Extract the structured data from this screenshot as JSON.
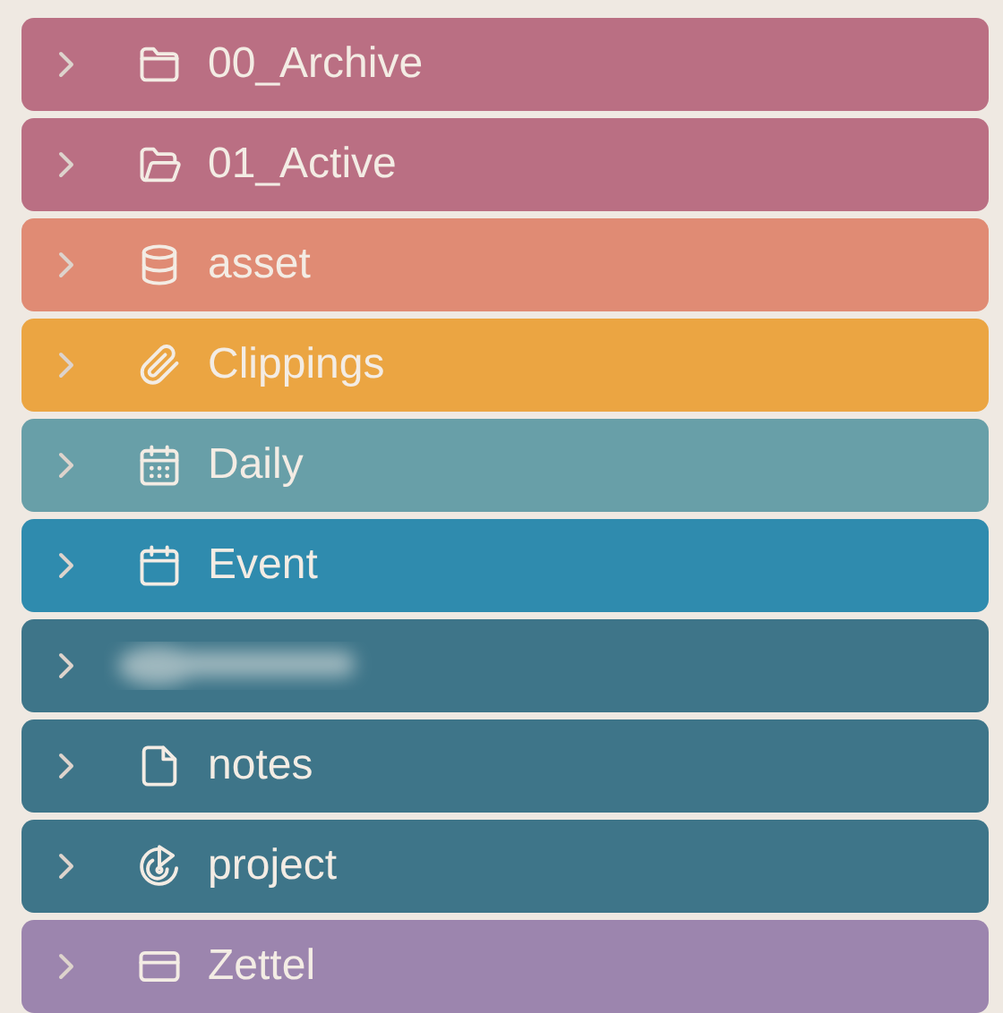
{
  "folders": [
    {
      "label": "00_Archive",
      "kind": "folder",
      "color": "#ba6f83",
      "expanded": false
    },
    {
      "label": "01_Active",
      "kind": "folder-open",
      "color": "#ba6f83",
      "expanded": false
    },
    {
      "label": "asset",
      "kind": "database",
      "color": "#e08b74",
      "expanded": false
    },
    {
      "label": "Clippings",
      "kind": "paperclip",
      "color": "#eba542",
      "expanded": false
    },
    {
      "label": "Daily",
      "kind": "calendar-grid",
      "color": "#689fa8",
      "expanded": false
    },
    {
      "label": "Event",
      "kind": "calendar",
      "color": "#2f8bae",
      "expanded": false
    },
    {
      "kind": "blurred",
      "color": "#3e7589",
      "expanded": false
    },
    {
      "label": "notes",
      "kind": "file",
      "color": "#3e7589",
      "expanded": false
    },
    {
      "label": "project",
      "kind": "target",
      "color": "#3e7589",
      "expanded": false
    },
    {
      "label": "Zettel",
      "kind": "card",
      "color": "#9c85ae",
      "expanded": false
    }
  ]
}
